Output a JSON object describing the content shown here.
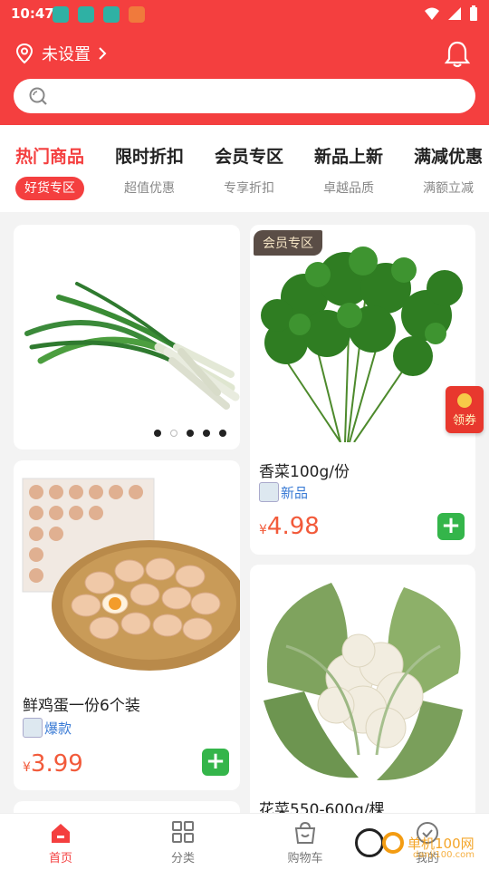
{
  "status_bar": {
    "time": "10:47"
  },
  "header": {
    "location_label": "未设置",
    "search_placeholder": ""
  },
  "tabs": [
    {
      "title": "热门商品",
      "subtitle": "好货专区",
      "active": true
    },
    {
      "title": "限时折扣",
      "subtitle": "超值优惠",
      "active": false
    },
    {
      "title": "会员专区",
      "subtitle": "专享折扣",
      "active": false
    },
    {
      "title": "新品上新",
      "subtitle": "卓越品质",
      "active": false
    },
    {
      "title": "满减优惠",
      "subtitle": "满额立减",
      "active": false
    }
  ],
  "banner": {
    "carousel_count": 5,
    "active_index": 1
  },
  "products": [
    {
      "name": "鲜鸡蛋一份6个装",
      "tag": "爆款",
      "currency": "¥",
      "price": "3.99"
    },
    {
      "badge": "会员专区",
      "name": "香菜100g/份",
      "tag": "新品",
      "currency": "¥",
      "price": "4.98"
    },
    {
      "name": "花菜550-600g/棵"
    }
  ],
  "coupon": {
    "label": "领券"
  },
  "bottom_nav": [
    {
      "label": "首页",
      "icon": "home-icon",
      "active": true
    },
    {
      "label": "分类",
      "icon": "grid-icon",
      "active": false
    },
    {
      "label": "购物车",
      "icon": "cart-icon",
      "active": false
    },
    {
      "label": "我的",
      "icon": "profile-icon",
      "active": false
    }
  ],
  "watermark": {
    "title": "单机100网",
    "url": "danji100.com"
  },
  "colors": {
    "brand_red": "#f43f3f",
    "price_orange": "#f25a3a",
    "add_green": "#34b54a",
    "tag_blue": "#3a7bd5"
  }
}
